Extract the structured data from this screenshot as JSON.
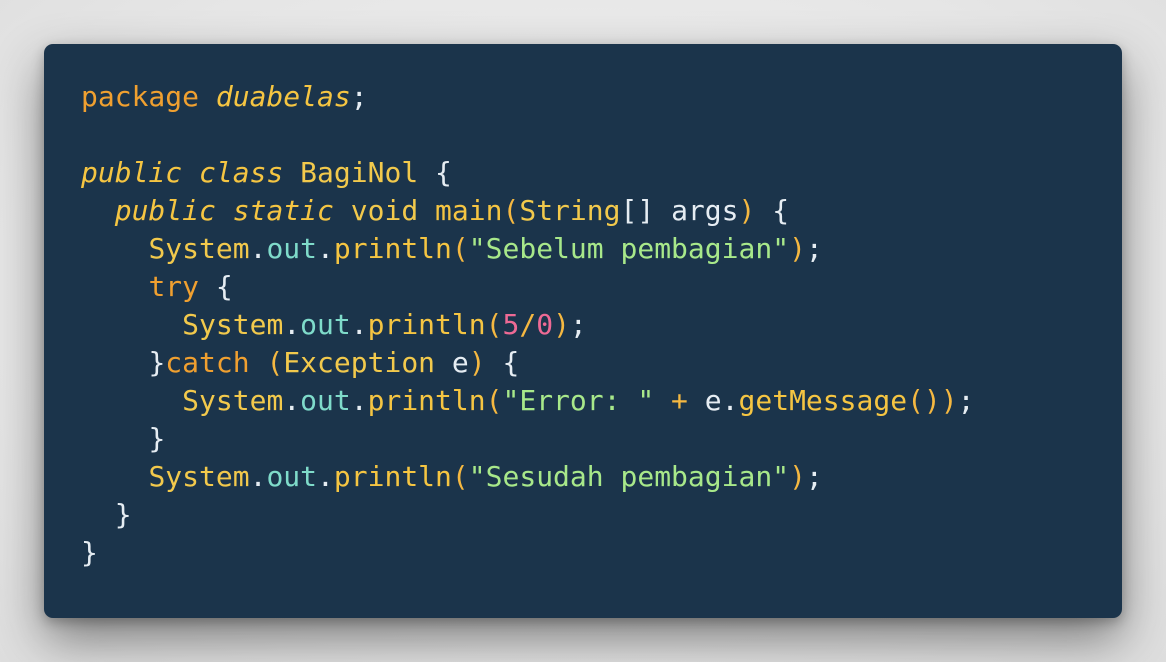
{
  "colors": {
    "background": "#1b344b",
    "keyword": "#f0a030",
    "italic_keyword": "#f5c542",
    "class_name": "#f2c94c",
    "property": "#7fdbca",
    "string": "#a8e88a",
    "number": "#ee6a95",
    "operator": "#f5b841",
    "plain": "#e6edf3"
  },
  "editor": {
    "lines": [
      {
        "indent": 0,
        "tokens": [
          {
            "t": "package ",
            "c": "#f0a030"
          },
          {
            "t": "duabelas",
            "c": "#f5c542",
            "i": true
          },
          {
            "t": ";",
            "c": "#e6edf3"
          }
        ]
      },
      {
        "indent": 0,
        "tokens": []
      },
      {
        "indent": 0,
        "tokens": [
          {
            "t": "public",
            "c": "#f5c542",
            "i": true
          },
          {
            "t": " ",
            "c": "#e6edf3"
          },
          {
            "t": "class",
            "c": "#f5c542",
            "i": true
          },
          {
            "t": " BagiNol ",
            "c": "#f2c94c"
          },
          {
            "t": "{",
            "c": "#e6edf3"
          }
        ]
      },
      {
        "indent": 1,
        "tokens": [
          {
            "t": "public",
            "c": "#f5c542",
            "i": true
          },
          {
            "t": " ",
            "c": "#e6edf3"
          },
          {
            "t": "static",
            "c": "#f5c542",
            "i": true
          },
          {
            "t": " void ",
            "c": "#f2c94c"
          },
          {
            "t": "main",
            "c": "#f5c542"
          },
          {
            "t": "(",
            "c": "#f5b841"
          },
          {
            "t": "String",
            "c": "#f2c94c"
          },
          {
            "t": "[] args",
            "c": "#e6edf3"
          },
          {
            "t": ")",
            "c": "#f5b841"
          },
          {
            "t": " {",
            "c": "#e6edf3"
          }
        ]
      },
      {
        "indent": 2,
        "tokens": [
          {
            "t": "System",
            "c": "#f2c94c"
          },
          {
            "t": ".",
            "c": "#e6edf3"
          },
          {
            "t": "out",
            "c": "#7fdbca"
          },
          {
            "t": ".",
            "c": "#e6edf3"
          },
          {
            "t": "println",
            "c": "#f5c542"
          },
          {
            "t": "(",
            "c": "#f5b841"
          },
          {
            "t": "\"Sebelum pembagian\"",
            "c": "#a8e88a"
          },
          {
            "t": ")",
            "c": "#f5b841"
          },
          {
            "t": ";",
            "c": "#e6edf3"
          }
        ]
      },
      {
        "indent": 2,
        "tokens": [
          {
            "t": "try",
            "c": "#f0a030"
          },
          {
            "t": " {",
            "c": "#e6edf3"
          }
        ]
      },
      {
        "indent": 3,
        "tokens": [
          {
            "t": "System",
            "c": "#f2c94c"
          },
          {
            "t": ".",
            "c": "#e6edf3"
          },
          {
            "t": "out",
            "c": "#7fdbca"
          },
          {
            "t": ".",
            "c": "#e6edf3"
          },
          {
            "t": "println",
            "c": "#f5c542"
          },
          {
            "t": "(",
            "c": "#f5b841"
          },
          {
            "t": "5",
            "c": "#ee6a95"
          },
          {
            "t": "/",
            "c": "#f5b841"
          },
          {
            "t": "0",
            "c": "#ee6a95"
          },
          {
            "t": ")",
            "c": "#f5b841"
          },
          {
            "t": ";",
            "c": "#e6edf3"
          }
        ]
      },
      {
        "indent": 2,
        "tokens": [
          {
            "t": "}",
            "c": "#e6edf3"
          },
          {
            "t": "catch",
            "c": "#f0a030"
          },
          {
            "t": " ",
            "c": "#e6edf3"
          },
          {
            "t": "(",
            "c": "#f5b841"
          },
          {
            "t": "Exception",
            "c": "#f2c94c"
          },
          {
            "t": " e",
            "c": "#e6edf3"
          },
          {
            "t": ")",
            "c": "#f5b841"
          },
          {
            "t": " {",
            "c": "#e6edf3"
          }
        ]
      },
      {
        "indent": 3,
        "tokens": [
          {
            "t": "System",
            "c": "#f2c94c"
          },
          {
            "t": ".",
            "c": "#e6edf3"
          },
          {
            "t": "out",
            "c": "#7fdbca"
          },
          {
            "t": ".",
            "c": "#e6edf3"
          },
          {
            "t": "println",
            "c": "#f5c542"
          },
          {
            "t": "(",
            "c": "#f5b841"
          },
          {
            "t": "\"Error: \"",
            "c": "#a8e88a"
          },
          {
            "t": " + ",
            "c": "#f5b841"
          },
          {
            "t": "e",
            "c": "#e6edf3"
          },
          {
            "t": ".",
            "c": "#e6edf3"
          },
          {
            "t": "getMessage",
            "c": "#f5c542"
          },
          {
            "t": "())",
            "c": "#f5b841"
          },
          {
            "t": ";",
            "c": "#e6edf3"
          }
        ]
      },
      {
        "indent": 2,
        "tokens": [
          {
            "t": "}",
            "c": "#e6edf3"
          }
        ]
      },
      {
        "indent": 2,
        "tokens": [
          {
            "t": "System",
            "c": "#f2c94c"
          },
          {
            "t": ".",
            "c": "#e6edf3"
          },
          {
            "t": "out",
            "c": "#7fdbca"
          },
          {
            "t": ".",
            "c": "#e6edf3"
          },
          {
            "t": "println",
            "c": "#f5c542"
          },
          {
            "t": "(",
            "c": "#f5b841"
          },
          {
            "t": "\"Sesudah pembagian\"",
            "c": "#a8e88a"
          },
          {
            "t": ")",
            "c": "#f5b841"
          },
          {
            "t": ";",
            "c": "#e6edf3"
          }
        ]
      },
      {
        "indent": 1,
        "tokens": [
          {
            "t": "}",
            "c": "#e6edf3"
          }
        ]
      },
      {
        "indent": 0,
        "tokens": [
          {
            "t": "}",
            "c": "#e6edf3"
          }
        ]
      }
    ]
  }
}
